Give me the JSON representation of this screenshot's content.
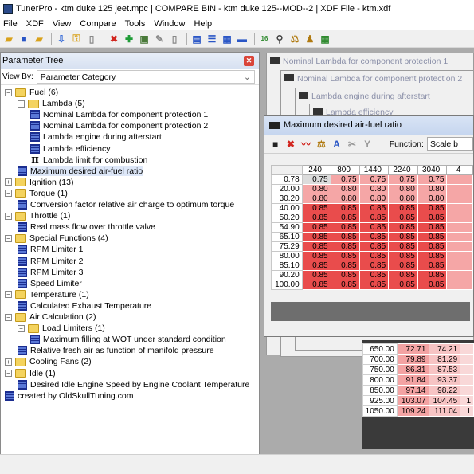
{
  "window": {
    "title": "TunerPro - ktm duke 125 jeet.mpc | COMPARE BIN - ktm duke 125--MOD--2 | XDF File - ktm.xdf"
  },
  "menu": [
    "File",
    "XDF",
    "View",
    "Compare",
    "Tools",
    "Window",
    "Help"
  ],
  "colors": {
    "selected_row": "#dde7f8",
    "cell_high": "#e94c4c",
    "cell_low": "#f5a6a6",
    "panel_header": "#d7e1f1"
  },
  "parameter_tree": {
    "title": "Parameter Tree",
    "view_by_label": "View By:",
    "view_by_value": "Parameter Category",
    "items": [
      {
        "label": "Fuel (6)",
        "type": "folder",
        "expanded": true
      },
      {
        "label": "Lambda (5)",
        "type": "folder",
        "expanded": true
      },
      {
        "label": "Nominal Lambda for component protection 1",
        "type": "table"
      },
      {
        "label": "Nominal Lambda for component protection 2",
        "type": "table"
      },
      {
        "label": "Lambda engine during afterstart",
        "type": "table"
      },
      {
        "label": "Lambda efficiency",
        "type": "table"
      },
      {
        "label": "Lambda limit for combustion",
        "type": "constant"
      },
      {
        "label": "Maximum desired air-fuel ratio",
        "type": "table",
        "selected": true
      },
      {
        "label": "Ignition (13)",
        "type": "folder",
        "expanded": false
      },
      {
        "label": "Torque (1)",
        "type": "folder",
        "expanded": true
      },
      {
        "label": "Conversion factor relative air charge to optimum torque",
        "type": "table"
      },
      {
        "label": "Throttle (1)",
        "type": "folder",
        "expanded": true
      },
      {
        "label": "Real mass flow over throttle valve",
        "type": "table"
      },
      {
        "label": "Special Functions (4)",
        "type": "folder",
        "expanded": true
      },
      {
        "label": "RPM Limiter 1",
        "type": "table"
      },
      {
        "label": "RPM Limiter 2",
        "type": "table"
      },
      {
        "label": "RPM Limiter 3",
        "type": "table"
      },
      {
        "label": "Speed Limiter",
        "type": "table"
      },
      {
        "label": "Temperature (1)",
        "type": "folder",
        "expanded": true
      },
      {
        "label": "Calculated Exhaust Temperature",
        "type": "table"
      },
      {
        "label": "Air Calculation (2)",
        "type": "folder",
        "expanded": true
      },
      {
        "label": "Load Limiters (1)",
        "type": "folder",
        "expanded": true
      },
      {
        "label": "Maximum filling at WOT under standard condition",
        "type": "table"
      },
      {
        "label": "Relative fresh air as function of manifold pressure",
        "type": "table"
      },
      {
        "label": "Cooling Fans (2)",
        "type": "folder",
        "expanded": false
      },
      {
        "label": "Idle (1)",
        "type": "folder",
        "expanded": true
      },
      {
        "label": "Desired Idle Engine Speed by Engine Coolant Temperature",
        "type": "table"
      },
      {
        "label": "created by OldSkullTuning.com",
        "type": "table"
      }
    ]
  },
  "background_windows": [
    "Nominal Lambda for component protection 1",
    "Nominal Lambda for component protection 2",
    "Lambda engine during afterstart",
    "Lambda efficiency"
  ],
  "table_window": {
    "title": "Maximum desired air-fuel ratio",
    "function_label": "Function:",
    "function_value": "Scale b",
    "x_axis": [
      "240",
      "800",
      "1440",
      "2240",
      "3040",
      "4"
    ],
    "y_axis": [
      "0.78",
      "20.00",
      "30.20",
      "40.00",
      "50.20",
      "54.90",
      "65.10",
      "75.29",
      "80.00",
      "85.10",
      "90.20",
      "100.00"
    ],
    "rows": [
      [
        "0.75",
        "0.75",
        "0.75",
        "0.75",
        "0.75",
        ""
      ],
      [
        "0.80",
        "0.80",
        "0.80",
        "0.80",
        "0.80",
        ""
      ],
      [
        "0.80",
        "0.80",
        "0.80",
        "0.80",
        "0.80",
        ""
      ],
      [
        "0.85",
        "0.85",
        "0.85",
        "0.85",
        "0.85",
        ""
      ],
      [
        "0.85",
        "0.85",
        "0.85",
        "0.85",
        "0.85",
        ""
      ],
      [
        "0.85",
        "0.85",
        "0.85",
        "0.85",
        "0.85",
        ""
      ],
      [
        "0.85",
        "0.85",
        "0.85",
        "0.85",
        "0.85",
        ""
      ],
      [
        "0.85",
        "0.85",
        "0.85",
        "0.85",
        "0.85",
        ""
      ],
      [
        "0.85",
        "0.85",
        "0.85",
        "0.85",
        "0.85",
        ""
      ],
      [
        "0.85",
        "0.85",
        "0.85",
        "0.85",
        "0.85",
        ""
      ],
      [
        "0.85",
        "0.85",
        "0.85",
        "0.85",
        "0.85",
        ""
      ],
      [
        "0.85",
        "0.85",
        "0.85",
        "0.85",
        "0.85",
        ""
      ]
    ]
  },
  "lower_table": {
    "rows": [
      [
        "650.00",
        "72.71",
        "74.21",
        ""
      ],
      [
        "700.00",
        "79.89",
        "81.29",
        ""
      ],
      [
        "750.00",
        "86.31",
        "87.53",
        ""
      ],
      [
        "800.00",
        "91.84",
        "93.37",
        ""
      ],
      [
        "850.00",
        "97.14",
        "98.22",
        ""
      ],
      [
        "925.00",
        "103.07",
        "104.45",
        "1"
      ],
      [
        "1050.00",
        "109.24",
        "111.04",
        "1"
      ]
    ]
  }
}
